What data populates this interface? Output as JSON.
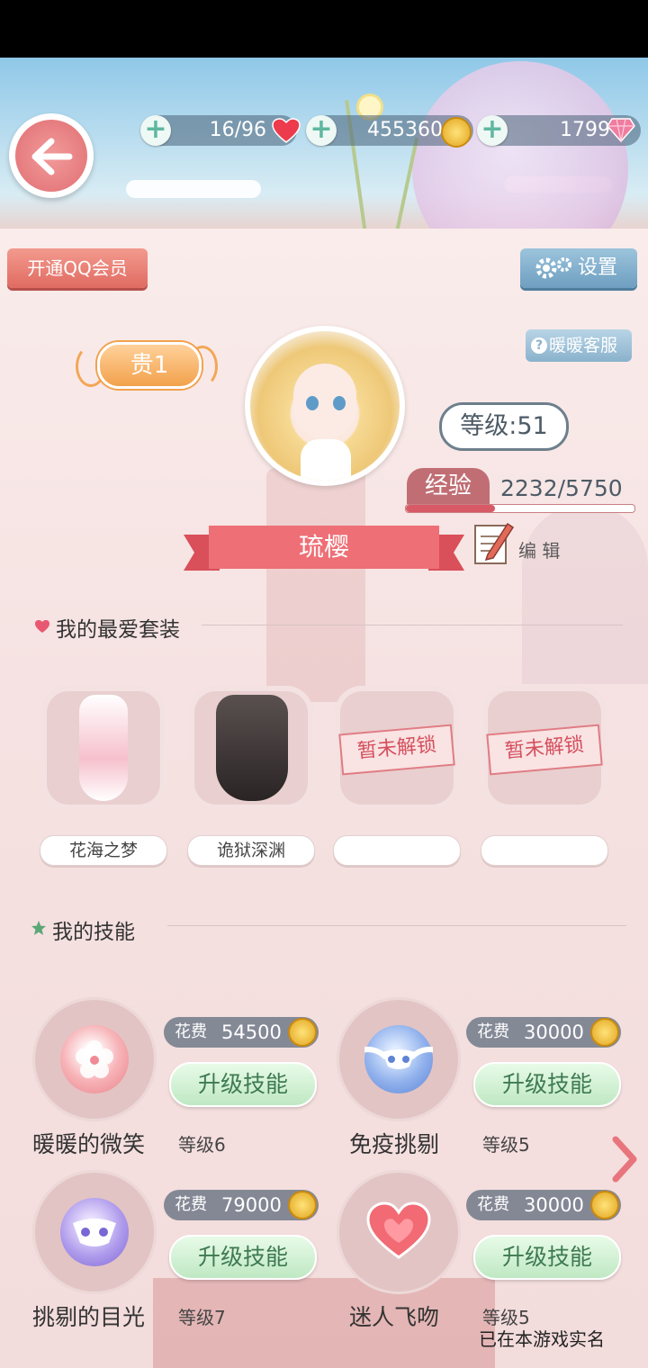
{
  "header": {
    "hearts": "16/96",
    "coins": "455360",
    "diamonds": "1799"
  },
  "buttons": {
    "qq_member": "开通QQ会员",
    "settings": "设置",
    "customer_service": "暖暖客服",
    "edit": "编 辑"
  },
  "profile": {
    "vip": "贵1",
    "level": "等级:51",
    "exp_label": "经验",
    "exp_value": "2232/5750",
    "exp_progress": 0.388,
    "name": "琉樱"
  },
  "favorites": {
    "title": "我的最爱套装",
    "items": [
      {
        "name": "花海之梦",
        "locked_text": ""
      },
      {
        "name": "诡狱深渊",
        "locked_text": ""
      },
      {
        "name": "",
        "locked_text": "暂未解锁"
      },
      {
        "name": "",
        "locked_text": "暂未解锁"
      }
    ]
  },
  "skills": {
    "title": "我的技能",
    "cost_label": "花费",
    "upgrade_label": "升级技能",
    "items": [
      {
        "name": "暖暖的微笑",
        "level": "等级6",
        "cost": "54500",
        "icon": "sakura-icon"
      },
      {
        "name": "免疫挑剔",
        "level": "等级5",
        "cost": "30000",
        "icon": "winged-mask-icon"
      },
      {
        "name": "挑剔的目光",
        "level": "等级7",
        "cost": "79000",
        "icon": "mask-icon"
      },
      {
        "name": "迷人飞吻",
        "level": "等级5",
        "cost": "30000",
        "icon": "heart-icon"
      }
    ]
  },
  "footer": {
    "realname": "已在本游戏实名"
  },
  "colors": {
    "accent_red": "#ee6f76",
    "accent_green": "#3e7a52",
    "panel_pink": "#e9cfcf"
  }
}
